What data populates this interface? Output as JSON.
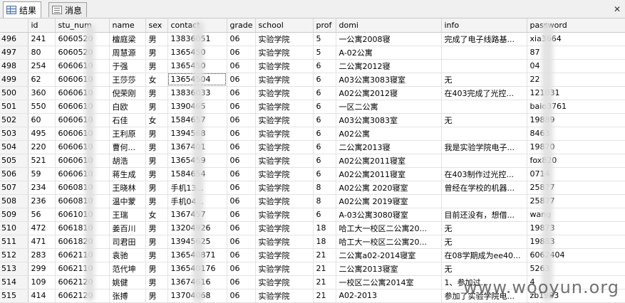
{
  "tabs": [
    {
      "label": "结果",
      "icon": "grid-icon",
      "active": true
    },
    {
      "label": "消息",
      "icon": "message-icon",
      "active": false
    }
  ],
  "columns": [
    "",
    "id",
    "stu_num",
    "name",
    "sex",
    "contact",
    "grade",
    "school",
    "prof",
    "domi",
    "info",
    "password"
  ],
  "rows": [
    [
      "496",
      "241",
      "6060520",
      "檀庭梁",
      "男",
      "13836051",
      "06",
      "实验学院",
      "5",
      "一公寓2008寝",
      "完成了电子线路基...",
      "xia3664"
    ],
    [
      "497",
      "80",
      "6060520",
      "周慧源",
      "男",
      "1365450",
      "06",
      "实验学院",
      "5",
      "A-02公寓",
      "",
      "87"
    ],
    [
      "498",
      "254",
      "6060610",
      "于强",
      "男",
      "1365450",
      "06",
      "实验学院",
      "6",
      "二公寓2012寝",
      "",
      "04"
    ],
    [
      "499",
      "62",
      "6060610",
      "王莎莎",
      "女",
      "13654504",
      "06",
      "实验学院",
      "6",
      "A03公寓3083寝室",
      "无",
      "22"
    ],
    [
      "500",
      "360",
      "6060610",
      "倪荣刚",
      "男",
      "13836033",
      "06",
      "实验学院",
      "6",
      "A02公寓2012寝",
      "在403完成了光控...",
      "121031"
    ],
    [
      "501",
      "550",
      "6060610",
      "白欧",
      "男",
      "1390465",
      "06",
      "实验学院",
      "6",
      "一区二公寓",
      "",
      "baio3761"
    ],
    [
      "502",
      "60",
      "6060610",
      "石佳",
      "女",
      "1584657",
      "06",
      "实验学院",
      "6",
      "A03公寓3083室",
      "无",
      "19889"
    ],
    [
      "503",
      "495",
      "6060610",
      "王利原",
      "男",
      "1394568",
      "06",
      "实验学院",
      "6",
      "A02公寓",
      "",
      "8463"
    ],
    [
      "504",
      "220",
      "6060610",
      "曹何...",
      "男",
      "1367401",
      "06",
      "实验学院",
      "6",
      "二公寓2013寝",
      "我是实验学院电子...",
      "19870"
    ],
    [
      "505",
      "521",
      "6060610",
      "胡浩",
      "男",
      "1365459",
      "06",
      "实验学院",
      "6",
      "A02公寓2011寝室",
      "",
      "fox820"
    ],
    [
      "506",
      "59",
      "6060610",
      "蒋生成",
      "男",
      "1584654",
      "06",
      "实验学院",
      "6",
      "A02公寓2011寝室",
      "在403制作过光控...",
      "0714"
    ],
    [
      "507",
      "234",
      "6060810",
      "王晓林",
      "男",
      "手机13...",
      "06",
      "实验学院",
      "8",
      "A02公寓 2020寝室",
      "曾经在学校的机器...",
      "25877"
    ],
    [
      "508",
      "236",
      "6060810",
      "温中蒙",
      "男",
      "手机04...",
      "06",
      "实验学院",
      "8",
      "A02公寓 2019寝室",
      "",
      "25877"
    ],
    [
      "509",
      "56",
      "6061010",
      "王瑞",
      "女",
      "1367457",
      "06",
      "实验学院",
      "6",
      "A-03公寓3080寝室",
      "目前还没有，想借...",
      "wang"
    ],
    [
      "510",
      "472",
      "6061810",
      "姜百川",
      "男",
      "13204926",
      "06",
      "实验学院",
      "18",
      "哈工大一校区二公寓20...",
      "无",
      "19873"
    ],
    [
      "511",
      "471",
      "6061820",
      "司君田",
      "男",
      "13945625",
      "06",
      "实验学院",
      "18",
      "哈工大一校区二公寓20...",
      "无",
      "19883"
    ],
    [
      "512",
      "283",
      "6062110",
      "袁驰",
      "男",
      "136540871",
      "06",
      "实验学院",
      "21",
      "二公寓a02-2014寝室",
      "在08学期成为ee40...",
      "6062404"
    ],
    [
      "513",
      "299",
      "6062110",
      "范代坤",
      "男",
      "136540176",
      "06",
      "实验学院",
      "21",
      "二公寓2013寝室",
      "无",
      "5263"
    ],
    [
      "514",
      "109",
      "6062120",
      "姚健",
      "男",
      "13674616",
      "06",
      "实验学院",
      "21",
      "一校区二公寓2014室",
      "1、参加过...",
      "4"
    ],
    [
      "515",
      "414",
      "6062120",
      "张搏",
      "男",
      "13704068",
      "06",
      "实验学院",
      "21",
      "A02-2013",
      "参加了实验学院电...",
      "zb1983"
    ]
  ],
  "watermark": "www.wooyun.org"
}
